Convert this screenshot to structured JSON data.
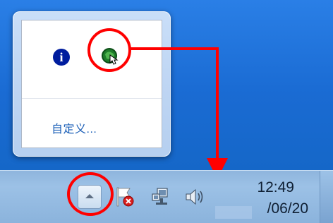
{
  "flyout": {
    "customize_label": "自定义..."
  },
  "icons": {
    "info": "info-icon",
    "app": "app-icon",
    "flag": "action-center-flag-icon",
    "network": "network-icon",
    "volume": "volume-icon",
    "show_hidden": "show-hidden-icons-arrow"
  },
  "clock": {
    "time": "12:49",
    "date": "/06/20"
  },
  "colors": {
    "highlight": "#ff0000",
    "link": "#1b5fb7",
    "info_blue": "#001d9e"
  }
}
